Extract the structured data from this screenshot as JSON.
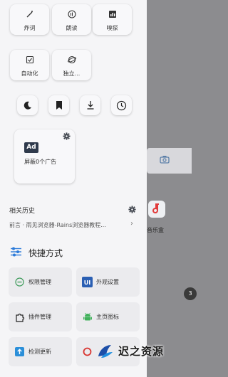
{
  "tools_row1": [
    {
      "label": "炸词",
      "icon": "magic-wand-icon"
    },
    {
      "label": "朗读",
      "icon": "read-aloud-icon"
    },
    {
      "label": "嗅探",
      "icon": "sniff-chart-icon"
    }
  ],
  "tools_row2": [
    {
      "label": "自动化",
      "icon": "automation-check-icon"
    },
    {
      "label": "独立...",
      "icon": "planet-icon"
    }
  ],
  "quick_icons": [
    "night-mode-icon",
    "bookmark-icon",
    "download-icon",
    "history-clock-icon"
  ],
  "ad_card": {
    "badge": "Ad",
    "label": "屏蔽0个广告"
  },
  "history": {
    "title": "相关历史",
    "entry": "前言 · 雨见浏览器-Rains浏览器教程..."
  },
  "shortcuts": {
    "title": "快捷方式",
    "items": [
      {
        "label": "权限管理",
        "icon": "permission-icon"
      },
      {
        "label": "外观设置",
        "icon": "ui-appearance-icon"
      },
      {
        "label": "插件管理",
        "icon": "plugin-icon"
      },
      {
        "label": "主页图标",
        "icon": "android-icon"
      },
      {
        "label": "检测更新",
        "icon": "update-icon"
      },
      {
        "label": "",
        "icon": "red-icon"
      }
    ]
  },
  "background": {
    "app_label": "音乐盒",
    "edge_button": "3"
  },
  "watermark": {
    "text": "迟之资源"
  },
  "colors": {
    "drawer_bg": "#f5f5f7",
    "scrim": "#8c8c8f",
    "accent_blue": "#2b7ad9",
    "ad_badge": "#2f3a4c"
  }
}
